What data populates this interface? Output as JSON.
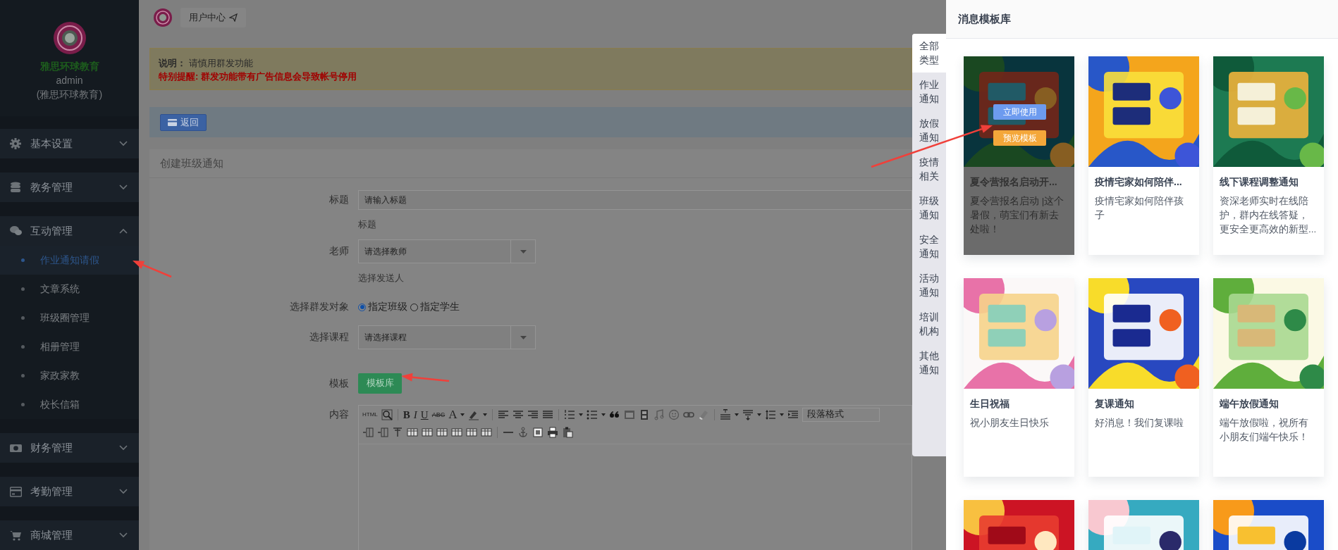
{
  "sidebar": {
    "brand": "雅思环球教育",
    "user": "admin",
    "org": "(雅思环球教育)",
    "menu": [
      {
        "label": "基本设置",
        "expanded": false
      },
      {
        "label": "教务管理",
        "expanded": false
      },
      {
        "label": "互动管理",
        "expanded": true,
        "children": [
          {
            "label": "作业通知请假",
            "selected": true
          },
          {
            "label": "文章系统",
            "selected": false
          },
          {
            "label": "班级圈管理",
            "selected": false
          },
          {
            "label": "相册管理",
            "selected": false
          },
          {
            "label": "家政家教",
            "selected": false
          },
          {
            "label": "校长信箱",
            "selected": false
          }
        ]
      },
      {
        "label": "财务管理",
        "expanded": false
      },
      {
        "label": "考勤管理",
        "expanded": false
      },
      {
        "label": "商城管理",
        "expanded": false
      }
    ]
  },
  "header": {
    "user_center": "用户中心"
  },
  "notice": {
    "text": "**说明：** 请慎用群发功能",
    "warning": "特别提醒: 群发功能带有广告信息会导致帐号停用"
  },
  "back_button": "返回",
  "form": {
    "title": "创建班级通知",
    "title_field": {
      "label": "标题",
      "placeholder": "请输入标题",
      "help": "标题"
    },
    "teacher_field": {
      "label": "老师",
      "value": "请选择教师",
      "help": "选择发送人"
    },
    "target_field": {
      "label": "选择群发对象",
      "options": [
        {
          "label": "指定班级",
          "selected": true
        },
        {
          "label": "指定学生",
          "selected": false
        }
      ]
    },
    "course_field": {
      "label": "选择课程",
      "value": "请选择课程"
    },
    "template_field": {
      "label": "模板",
      "button": "模板库"
    },
    "content_field": {
      "label": "内容",
      "toolbar_texts": [
        "HTML",
        "B",
        "I",
        "U",
        "ABC",
        "A"
      ],
      "format_select": "段落格式"
    }
  },
  "drawer": {
    "title": "消息模板库",
    "categories": [
      {
        "label": "全部类型",
        "selected": true
      },
      {
        "label": "作业通知",
        "selected": false
      },
      {
        "label": "放假通知",
        "selected": false
      },
      {
        "label": "疫情相关",
        "selected": false
      },
      {
        "label": "班级通知",
        "selected": false
      },
      {
        "label": "安全通知",
        "selected": false
      },
      {
        "label": "活动通知",
        "selected": false
      },
      {
        "label": "培训机构",
        "selected": false
      },
      {
        "label": "其他通知",
        "selected": false
      }
    ],
    "cards": [
      {
        "title": "夏令营报名启动开...",
        "description": "夏令营报名启动 |这个暑假，萌宝们有新去处啦！",
        "hovered": true,
        "actions": [
          "立即使用",
          "预览模板"
        ]
      },
      {
        "title": "疫情宅家如何陪伴...",
        "description": "疫情宅家如何陪伴孩子",
        "hovered": false
      },
      {
        "title": "线下课程调整通知",
        "description": "资深老师实时在线陪护，群内在线答疑，更安全更高效的新型...",
        "hovered": false
      },
      {
        "title": "生日祝福",
        "description": "祝小朋友生日快乐",
        "hovered": false
      },
      {
        "title": "复课通知",
        "description": "好消息！我们复课啦",
        "hovered": false
      },
      {
        "title": "端午放假通知",
        "description": "端午放假啦，祝所有小朋友们端午快乐！",
        "hovered": false
      },
      {
        "hovered": false
      },
      {
        "hovered": false
      },
      {
        "hovered": false
      }
    ]
  }
}
